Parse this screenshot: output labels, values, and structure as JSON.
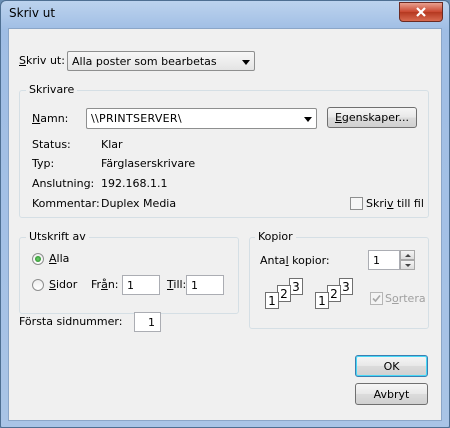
{
  "window": {
    "title": "Skriv ut"
  },
  "print_what": {
    "label": "Skriv ut:",
    "selected": "Alla poster som bearbetas"
  },
  "printer": {
    "legend": "Skrivare",
    "name_label": "Namn:",
    "name_value": "\\\\PRINTSERVER\\",
    "properties_button": "Egenskaper...",
    "status_label": "Status:",
    "status_value": "Klar",
    "type_label": "Typ:",
    "type_value": "Färglaserskrivare",
    "connection_label": "Anslutning:",
    "connection_value": "192.168.1.1",
    "comment_label": "Kommentar:",
    "comment_value": "Duplex Media",
    "print_to_file_label": "Skriv till fil"
  },
  "range": {
    "legend": "Utskrift av",
    "all_label": "Alla",
    "pages_label": "Sidor",
    "from_label": "Från:",
    "from_value": "1",
    "to_label": "Till:",
    "to_value": "1"
  },
  "copies": {
    "legend": "Kopior",
    "count_label": "Antal kopior:",
    "count_value": "1",
    "collate_label": "Sortera",
    "icon_pages": [
      "1",
      "2",
      "3",
      "1",
      "2",
      "3"
    ]
  },
  "first_page": {
    "label": "Första sidnummer:",
    "value": "1"
  },
  "buttons": {
    "ok": "OK",
    "cancel": "Avbryt"
  }
}
